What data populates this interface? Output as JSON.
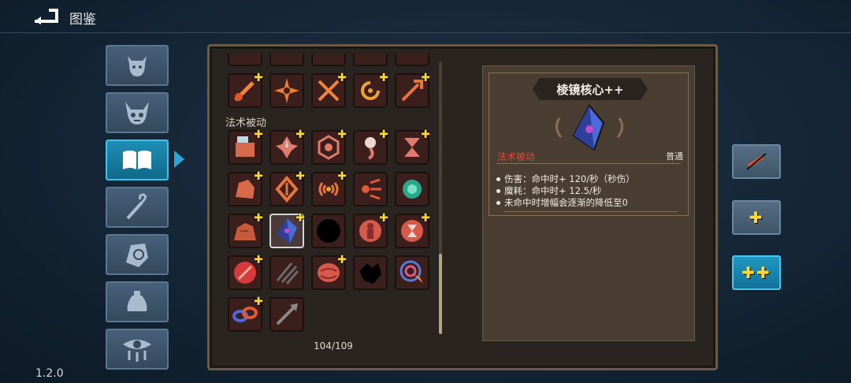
{
  "header": {
    "title": "图鉴"
  },
  "version": "1.2.0",
  "sidebar": {
    "items": [
      {
        "name": "sidebar-item-characters",
        "icon": "devil-face-icon"
      },
      {
        "name": "sidebar-item-monsters",
        "icon": "horned-skull-icon"
      },
      {
        "name": "sidebar-item-codex",
        "icon": "book-icon",
        "active": true
      },
      {
        "name": "sidebar-item-staffs",
        "icon": "staff-icon"
      },
      {
        "name": "sidebar-item-relics",
        "icon": "hand-rune-icon"
      },
      {
        "name": "sidebar-item-items",
        "icon": "pouch-icon"
      },
      {
        "name": "sidebar-item-curses",
        "icon": "eye-icon"
      }
    ]
  },
  "grid": {
    "section_label": "法术被动",
    "count": "104/109"
  },
  "detail": {
    "title": "棱镜核心++",
    "category": "法术被动",
    "rarity": "普通",
    "lines": [
      "伤害：命中时+ 120/秒（秒伤）",
      "魔耗：命中时+ 12.5/秒",
      "未命中时增幅会逐渐的降低至0"
    ]
  },
  "upgrades": [
    {
      "label": "",
      "icon": "slashed-base-icon"
    },
    {
      "label": "✚"
    },
    {
      "label": "✚✚",
      "active": true
    }
  ],
  "colors": {
    "accent": "#2aa6d6",
    "plus": "#ffd83a",
    "category": "#e04a3a"
  }
}
